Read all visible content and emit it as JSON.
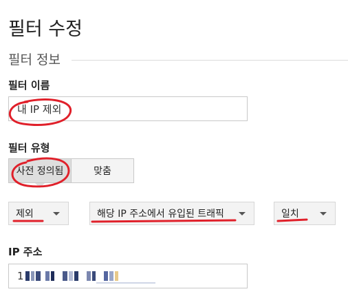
{
  "page": {
    "title": "필터 수정"
  },
  "section": {
    "header": "필터 정보"
  },
  "filter_name": {
    "label": "필터 이름",
    "value": "내 IP 제외"
  },
  "filter_type": {
    "label": "필터 유형",
    "options": [
      "사전 정의됨",
      "맞춤"
    ],
    "selected": "사전 정의됨"
  },
  "dropdowns": {
    "action": "제외",
    "source": "해당 IP 주소에서 유입된 트래픽",
    "match": "일치"
  },
  "ip_address": {
    "label": "IP 주소",
    "value": "1"
  },
  "annotation_color": "#e0202a"
}
